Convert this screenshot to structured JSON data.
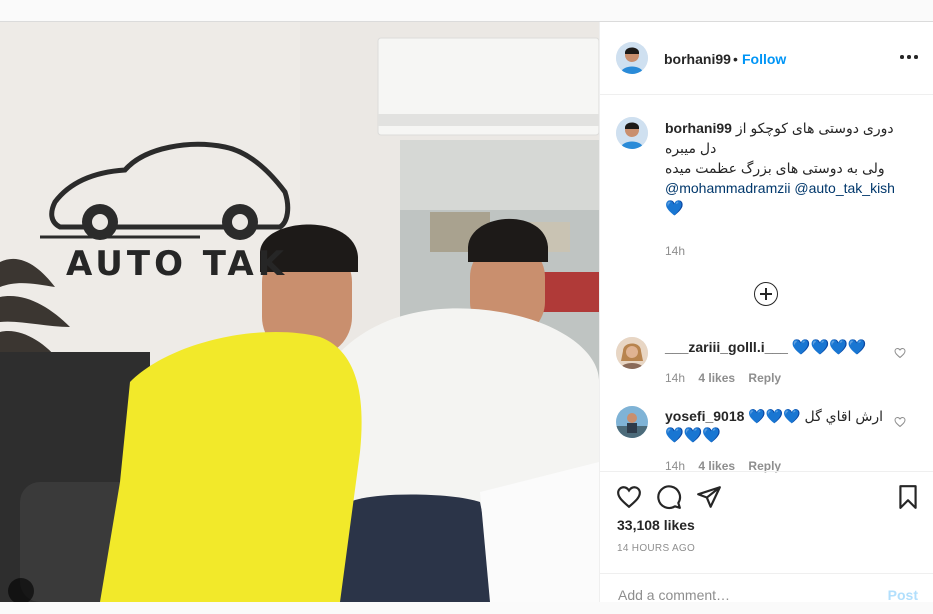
{
  "post": {
    "author": "borhani99",
    "follow_label": "Follow",
    "dot": "•",
    "caption_line1": "دوری دوستی های کوچکو از",
    "caption_line2": "دل میبره",
    "caption_line3": "ولی به دوستی های بزرگ عظمت میده",
    "mention1": "@mohammadramzii",
    "mention2": "@auto_tak_kish",
    "caption_heart": "💙",
    "caption_time": "14h",
    "likes": "33,108 likes",
    "time_ago": "14 HOURS AGO",
    "photo_sign": "AUTO TAK"
  },
  "comments": [
    {
      "username": "___zariii_golll.i___",
      "text": "💙💙💙💙",
      "time": "14h",
      "likes": "4 likes",
      "reply": "Reply"
    },
    {
      "username": "yosefi_9018",
      "text": "ارش اقاي گل 💙💙💙",
      "text2": "💙💙💙",
      "time": "14h",
      "likes": "4 likes",
      "reply": "Reply"
    }
  ],
  "add_comment": {
    "placeholder": "Add a comment…",
    "post_label": "Post"
  },
  "icons": {
    "like": "heart-outline-icon",
    "comment": "speech-bubble-icon",
    "share": "paper-plane-icon",
    "save": "bookmark-icon",
    "more": "ellipsis-icon",
    "load_more": "plus-circle-icon"
  },
  "colors": {
    "link_blue": "#0095f6",
    "mention": "#00376b",
    "secondary": "#8e8e8e",
    "shirt_yellow": "#f2e92a"
  }
}
